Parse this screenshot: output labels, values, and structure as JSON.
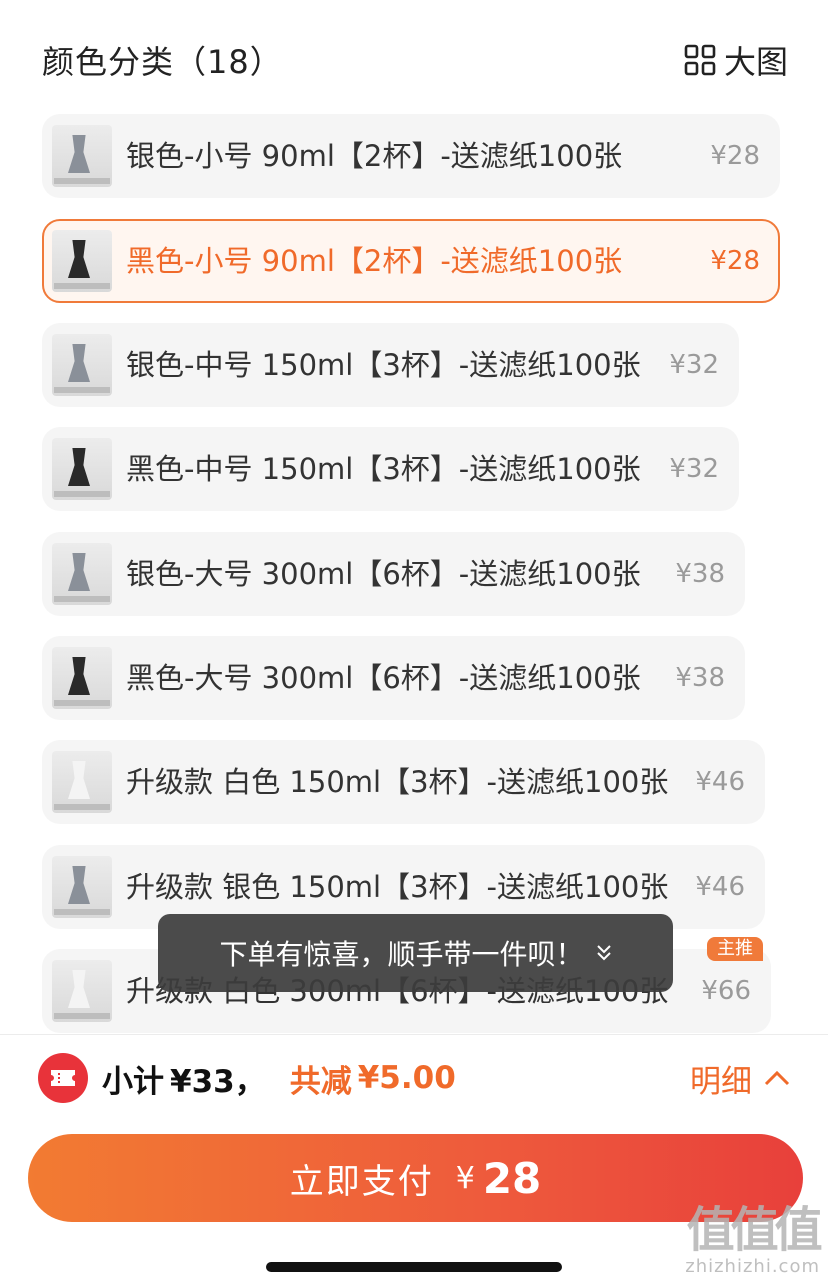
{
  "header": {
    "title": "颜色分类（18）",
    "big_image_label": "大图"
  },
  "items": [
    {
      "name": "银色-小号 90ml【2杯】-送滤纸100张",
      "price": "¥28",
      "selected": false,
      "color": "silver"
    },
    {
      "name": "黑色-小号 90ml【2杯】-送滤纸100张",
      "price": "¥28",
      "selected": true,
      "color": "black"
    },
    {
      "name": "银色-中号 150ml【3杯】-送滤纸100张",
      "price": "¥32",
      "selected": false,
      "color": "silver"
    },
    {
      "name": "黑色-中号 150ml【3杯】-送滤纸100张",
      "price": "¥32",
      "selected": false,
      "color": "black"
    },
    {
      "name": "银色-大号 300ml【6杯】-送滤纸100张",
      "price": "¥38",
      "selected": false,
      "color": "silver"
    },
    {
      "name": "黑色-大号 300ml【6杯】-送滤纸100张",
      "price": "¥38",
      "selected": false,
      "color": "black"
    },
    {
      "name": "升级款 白色 150ml【3杯】-送滤纸100张",
      "price": "¥46",
      "selected": false,
      "color": "white"
    },
    {
      "name": "升级款 银色 150ml【3杯】-送滤纸100张",
      "price": "¥46",
      "selected": false,
      "color": "silver"
    },
    {
      "name": "升级款 白色 300ml【6杯】-送滤纸100张",
      "price": "¥66",
      "selected": false,
      "color": "white",
      "badge": "主推"
    }
  ],
  "toast": {
    "text": "下单有惊喜，顺手带一件呗！",
    "icon": "double-chevron-down-icon"
  },
  "summary": {
    "subtotal_label": "小计",
    "subtotal_value": "¥33，",
    "discount_label": "共减",
    "discount_value": "¥5.00",
    "detail_label": "明细"
  },
  "pay": {
    "label": "立即支付",
    "currency": "¥",
    "amount": "28"
  },
  "watermark": {
    "logo": "值值值",
    "url": "zhizhizhi.com"
  },
  "colors": {
    "accent": "#f06a2a",
    "selected_border": "#f07a3a",
    "coupon_red": "#e8333a",
    "pay_gradient_start": "#f27b32",
    "pay_gradient_end": "#e8403b"
  }
}
